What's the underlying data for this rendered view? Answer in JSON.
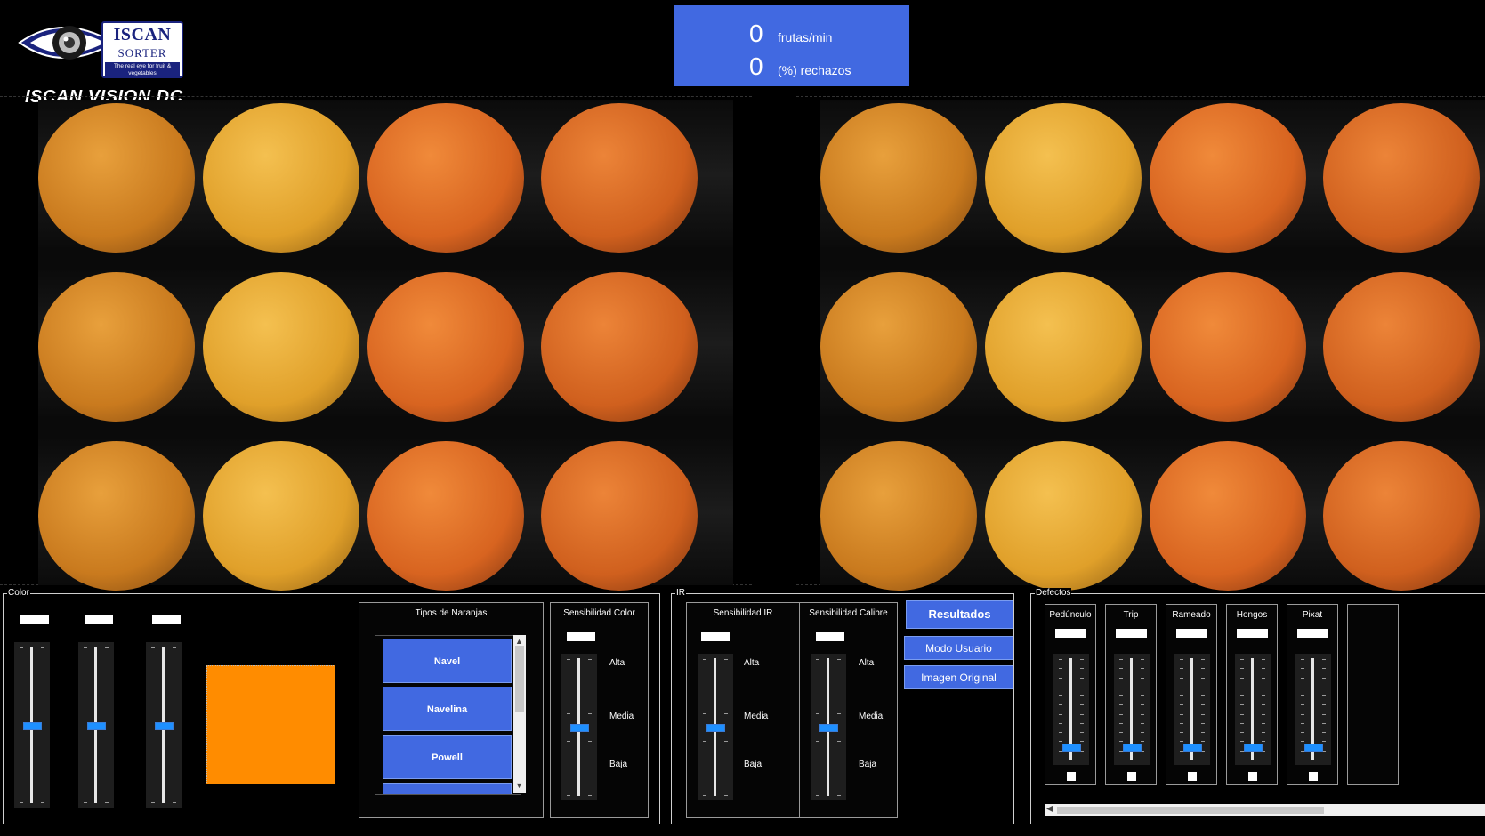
{
  "brand": {
    "logo_title": "ISCAN",
    "logo_subtitle": "SORTER",
    "logo_tagline": "The real eye for fruit & vegetables",
    "app_title": "ISCAN VISION DC"
  },
  "stats": {
    "fruits_value": "0",
    "fruits_label": "frutas/min",
    "rejects_value": "0",
    "rejects_label": "(%) rechazos"
  },
  "colors": {
    "accent": "#4169e1",
    "slider_thumb": "#1e90ff",
    "color_swatch": "#ff8c00"
  },
  "color_group": {
    "title": "Color",
    "sliders": [
      {
        "name": "r",
        "value_text": "",
        "level": 0.5
      },
      {
        "name": "g",
        "value_text": "",
        "level": 0.5
      },
      {
        "name": "b",
        "value_text": "",
        "level": 0.5
      }
    ],
    "swatch_color": "#ff8c00",
    "orange_types": {
      "title": "Tipos de  Naranjas",
      "items": [
        "Navel",
        "Navelina",
        "Powell"
      ]
    },
    "sens_color": {
      "title": "Sensibilidad Color",
      "alta": "Alta",
      "media": "Media",
      "baja": "Baja",
      "level": 0.5
    }
  },
  "ir_group": {
    "title": "IR",
    "sens_ir": {
      "title": "Sensibilidad IR",
      "alta": "Alta",
      "media": "Media",
      "baja": "Baja",
      "level": 0.5
    },
    "sens_calibre": {
      "title": "Sensibilidad Calibre",
      "alta": "Alta",
      "media": "Media",
      "baja": "Baja",
      "level": 0.5
    },
    "buttons": {
      "results": "Resultados",
      "user_mode": "Modo Usuario",
      "original_image": "Imagen Original"
    }
  },
  "defects_group": {
    "title": "Defectos",
    "items": [
      {
        "label": "Pedúnculo",
        "level": 0.1
      },
      {
        "label": "Trip",
        "level": 0.1
      },
      {
        "label": "Rameado",
        "level": 0.1
      },
      {
        "label": "Hongos",
        "level": 0.1
      },
      {
        "label": "Pixat",
        "level": 0.1
      }
    ]
  }
}
